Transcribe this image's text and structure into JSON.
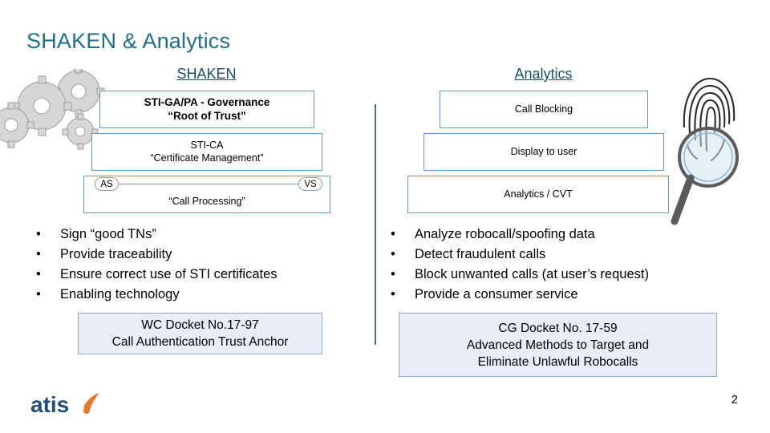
{
  "slide": {
    "title": "SHAKEN & Analytics",
    "page_number": "2",
    "columns": {
      "left_heading": "SHAKEN",
      "right_heading": "Analytics"
    },
    "shaken_boxes": [
      {
        "line1": "STI-GA/PA - Governance",
        "line2": "“Root of Trust”"
      },
      {
        "line1": "STI-CA",
        "line2": "“Certificate Management”"
      }
    ],
    "call_processing": {
      "as_label": "AS",
      "vs_label": "VS",
      "caption": "“Call Processing”"
    },
    "analytics_boxes": [
      {
        "label": "Call Blocking"
      },
      {
        "label": "Display to user"
      },
      {
        "label": "Analytics / CVT"
      }
    ],
    "left_bullets": [
      "Sign “good TNs”",
      "Provide traceability",
      "Ensure correct use of STI certificates",
      "Enabling technology"
    ],
    "right_bullets": [
      "Analyze robocall/spoofing data",
      "Detect fraudulent calls",
      "Block unwanted calls (at user’s request)",
      "Provide a consumer service"
    ],
    "bullet_marker": "•",
    "footer_left": {
      "line1": "WC Docket No.17-97",
      "line2": "Call Authentication Trust Anchor"
    },
    "footer_right": {
      "line1": "CG Docket No. 17-59",
      "line2": "Advanced Methods to Target and",
      "line3": "Eliminate Unlawful Robocalls"
    },
    "logo": {
      "text": "atis"
    },
    "colors": {
      "title": "#1F6F8B",
      "heading": "#17506B",
      "box_border": "#5B9BD5",
      "footer_fill": "#E8EDF7",
      "footer_border": "#8EA9DB",
      "divider": "#4F6E8C",
      "logo_accent": "#E8762C"
    }
  }
}
